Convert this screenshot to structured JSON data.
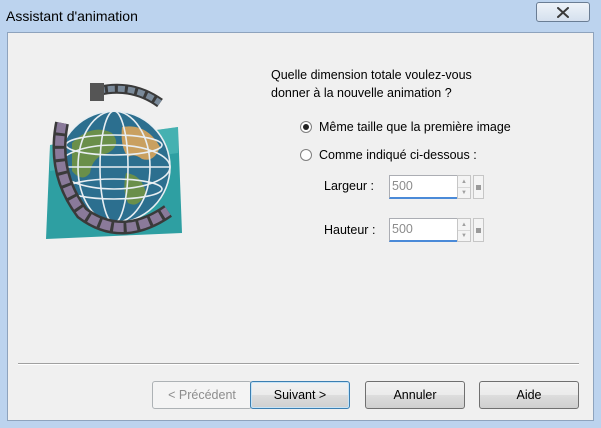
{
  "window": {
    "title": "Assistant d'animation"
  },
  "icons": {
    "close": "close-icon",
    "illustration": "globe-film-icon",
    "spin_up": "spin-up-icon",
    "spin_down": "spin-down-icon"
  },
  "question": {
    "line1": "Quelle dimension totale voulez-vous",
    "line2": "donner à la nouvelle animation ?"
  },
  "options": [
    {
      "label": "Même taille que la première image",
      "selected": true
    },
    {
      "label": "Comme indiqué ci-dessous :",
      "selected": false
    }
  ],
  "fields": {
    "width": {
      "label": "Largeur :",
      "value": "500"
    },
    "height": {
      "label": "Hauteur :",
      "value": "500"
    }
  },
  "buttons": {
    "previous": "< Précédent",
    "next": "Suivant >",
    "cancel": "Annuler",
    "help": "Aide"
  },
  "colors": {
    "frame": "#bcd3ee",
    "client": "#f0f0f0",
    "focus_underline": "#4a8ad8"
  }
}
